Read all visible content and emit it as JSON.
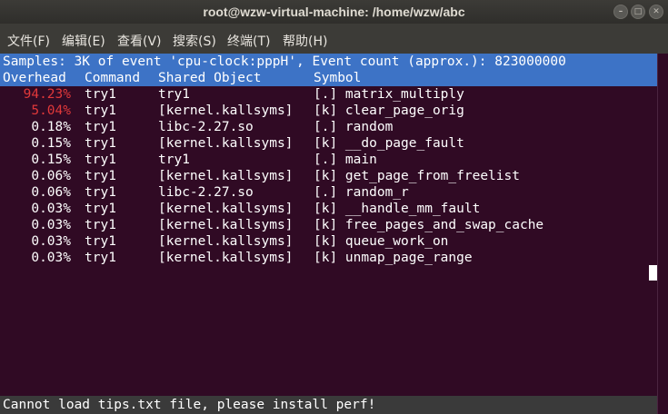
{
  "window": {
    "title": "root@wzw-virtual-machine: /home/wzw/abc",
    "minimize_glyph": "–",
    "maximize_glyph": "□",
    "close_glyph": "✕"
  },
  "menu": [
    "文件(F)",
    "编辑(E)",
    "查看(V)",
    "搜索(S)",
    "终端(T)",
    "帮助(H)"
  ],
  "perf": {
    "summary": "Samples: 3K of event 'cpu-clock:pppH', Event count (approx.): 823000000",
    "columns": {
      "overhead": "Overhead",
      "command": "Command",
      "shared_object": "Shared Object",
      "symbol": "Symbol"
    },
    "rows": [
      {
        "overhead": "94.23%",
        "command": "try1",
        "object": "try1",
        "symbol": "[.] matrix_multiply"
      },
      {
        "overhead": "5.04%",
        "command": "try1",
        "object": "[kernel.kallsyms]",
        "symbol": "[k] clear_page_orig"
      },
      {
        "overhead": "0.18%",
        "command": "try1",
        "object": "libc-2.27.so",
        "symbol": "[.] random"
      },
      {
        "overhead": "0.15%",
        "command": "try1",
        "object": "[kernel.kallsyms]",
        "symbol": "[k] __do_page_fault"
      },
      {
        "overhead": "0.15%",
        "command": "try1",
        "object": "try1",
        "symbol": "[.] main"
      },
      {
        "overhead": "0.06%",
        "command": "try1",
        "object": "[kernel.kallsyms]",
        "symbol": "[k] get_page_from_freelist"
      },
      {
        "overhead": "0.06%",
        "command": "try1",
        "object": "libc-2.27.so",
        "symbol": "[.] random_r"
      },
      {
        "overhead": "0.03%",
        "command": "try1",
        "object": "[kernel.kallsyms]",
        "symbol": "[k] __handle_mm_fault"
      },
      {
        "overhead": "0.03%",
        "command": "try1",
        "object": "[kernel.kallsyms]",
        "symbol": "[k] free_pages_and_swap_cache"
      },
      {
        "overhead": "0.03%",
        "command": "try1",
        "object": "[kernel.kallsyms]",
        "symbol": "[k] queue_work_on"
      },
      {
        "overhead": "0.03%",
        "command": "try1",
        "object": "[kernel.kallsyms]",
        "symbol": "[k] unmap_page_range"
      }
    ],
    "status": "Cannot load tips.txt file, please install perf!"
  },
  "colors": {
    "terminal_bg": "#300a24",
    "header_bg": "#3d73c6",
    "hot_overhead": "#e0383a"
  }
}
